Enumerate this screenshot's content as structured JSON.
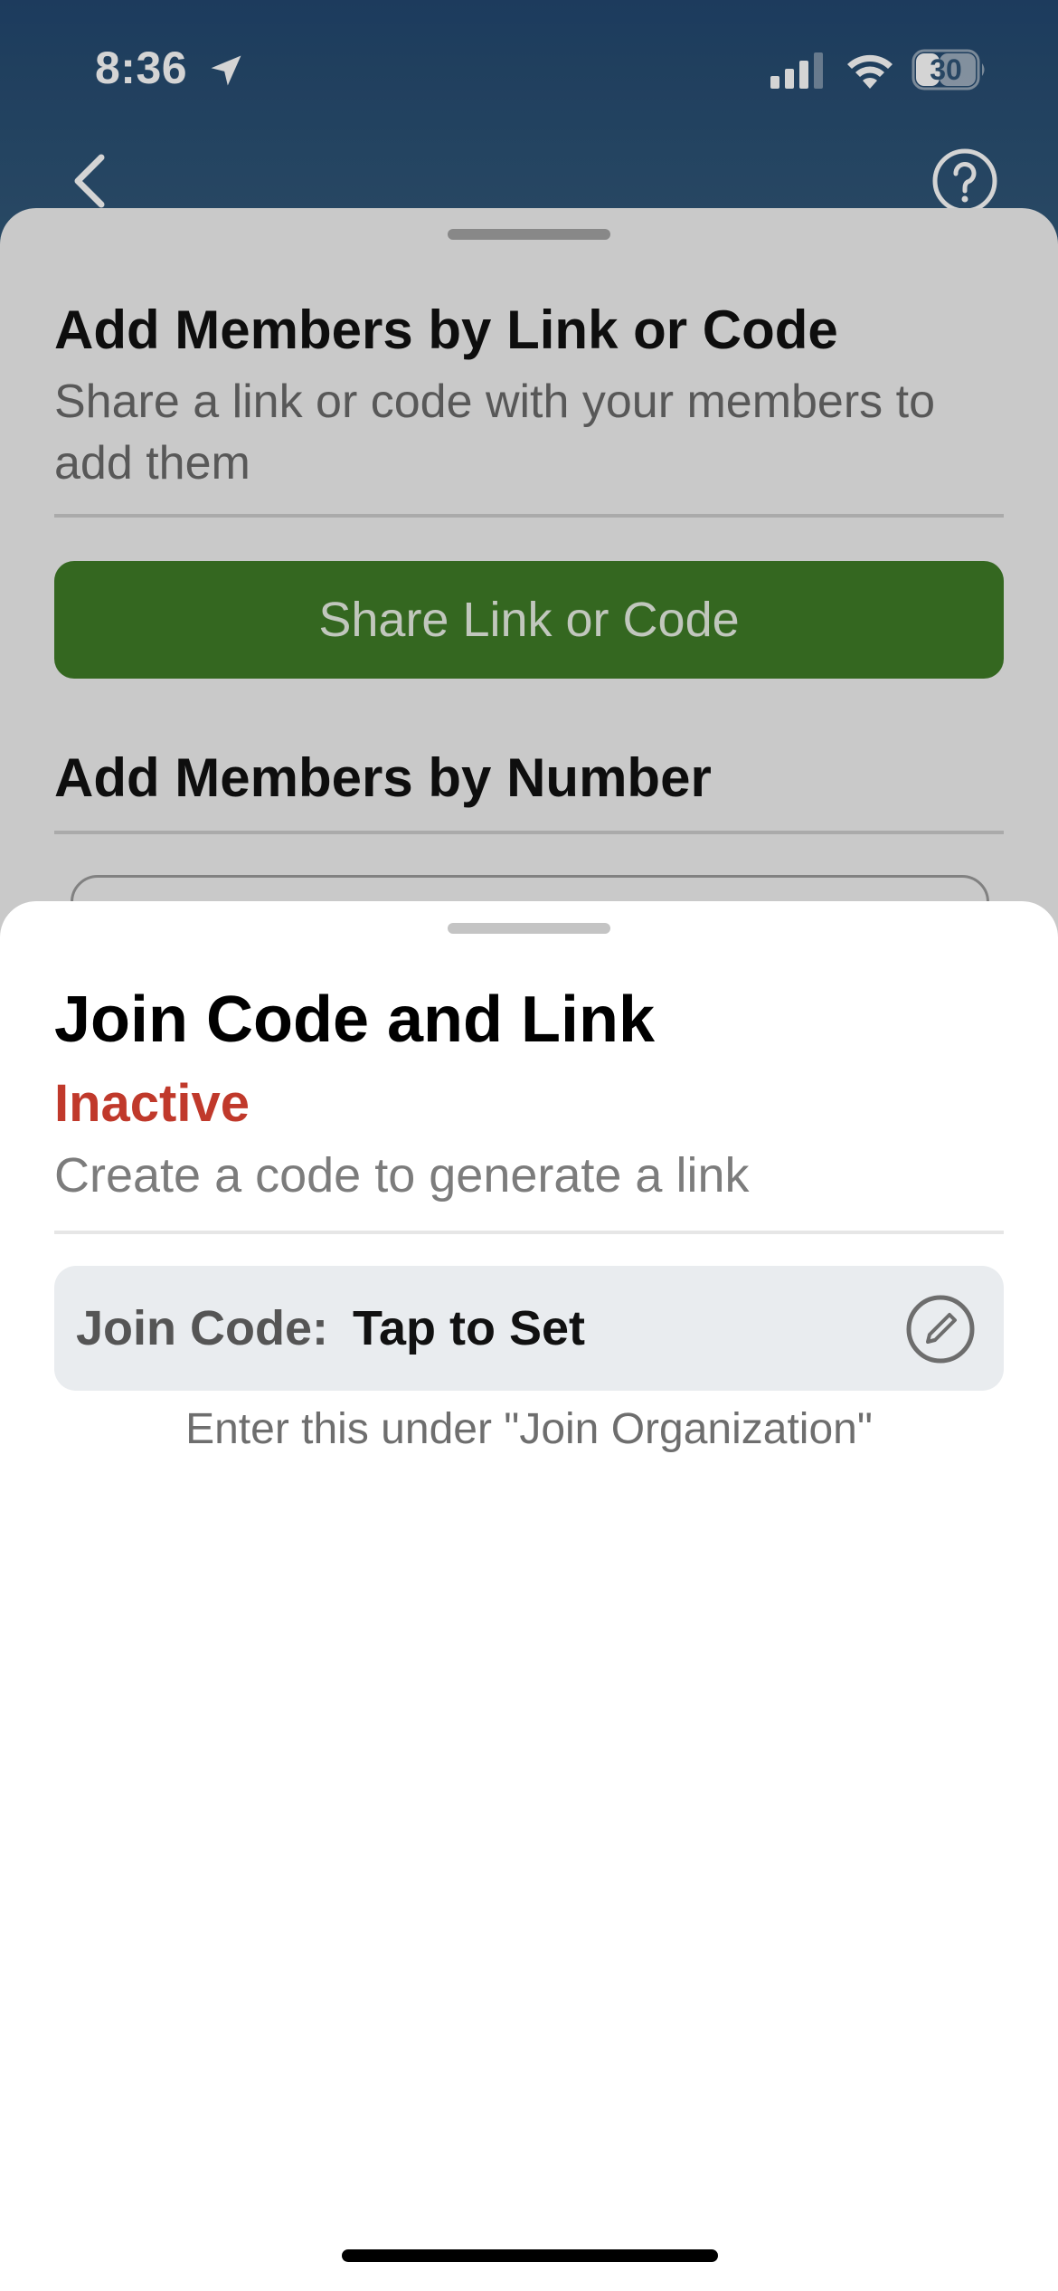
{
  "status_bar": {
    "time": "8:36",
    "battery": "30"
  },
  "nav": {
    "back_icon": "chevron-left-icon",
    "help_icon": "question-circle-icon"
  },
  "background_sheet": {
    "link_section_title": "Add Members by Link or Code",
    "link_section_subtitle": "Share a link or code with your members to add them",
    "share_button_label": "Share Link or Code",
    "number_section_title": "Add Members by Number",
    "share_button_color": "#3f7c27"
  },
  "join_sheet": {
    "title": "Join Code and Link",
    "status": "Inactive",
    "status_color": "#c0392b",
    "subtitle": "Create a code to generate a link",
    "code_label": "Join Code:",
    "code_value": "Tap to Set",
    "edit_icon": "pencil-circle-icon",
    "hint": "Enter this under \"Join Organization\""
  }
}
